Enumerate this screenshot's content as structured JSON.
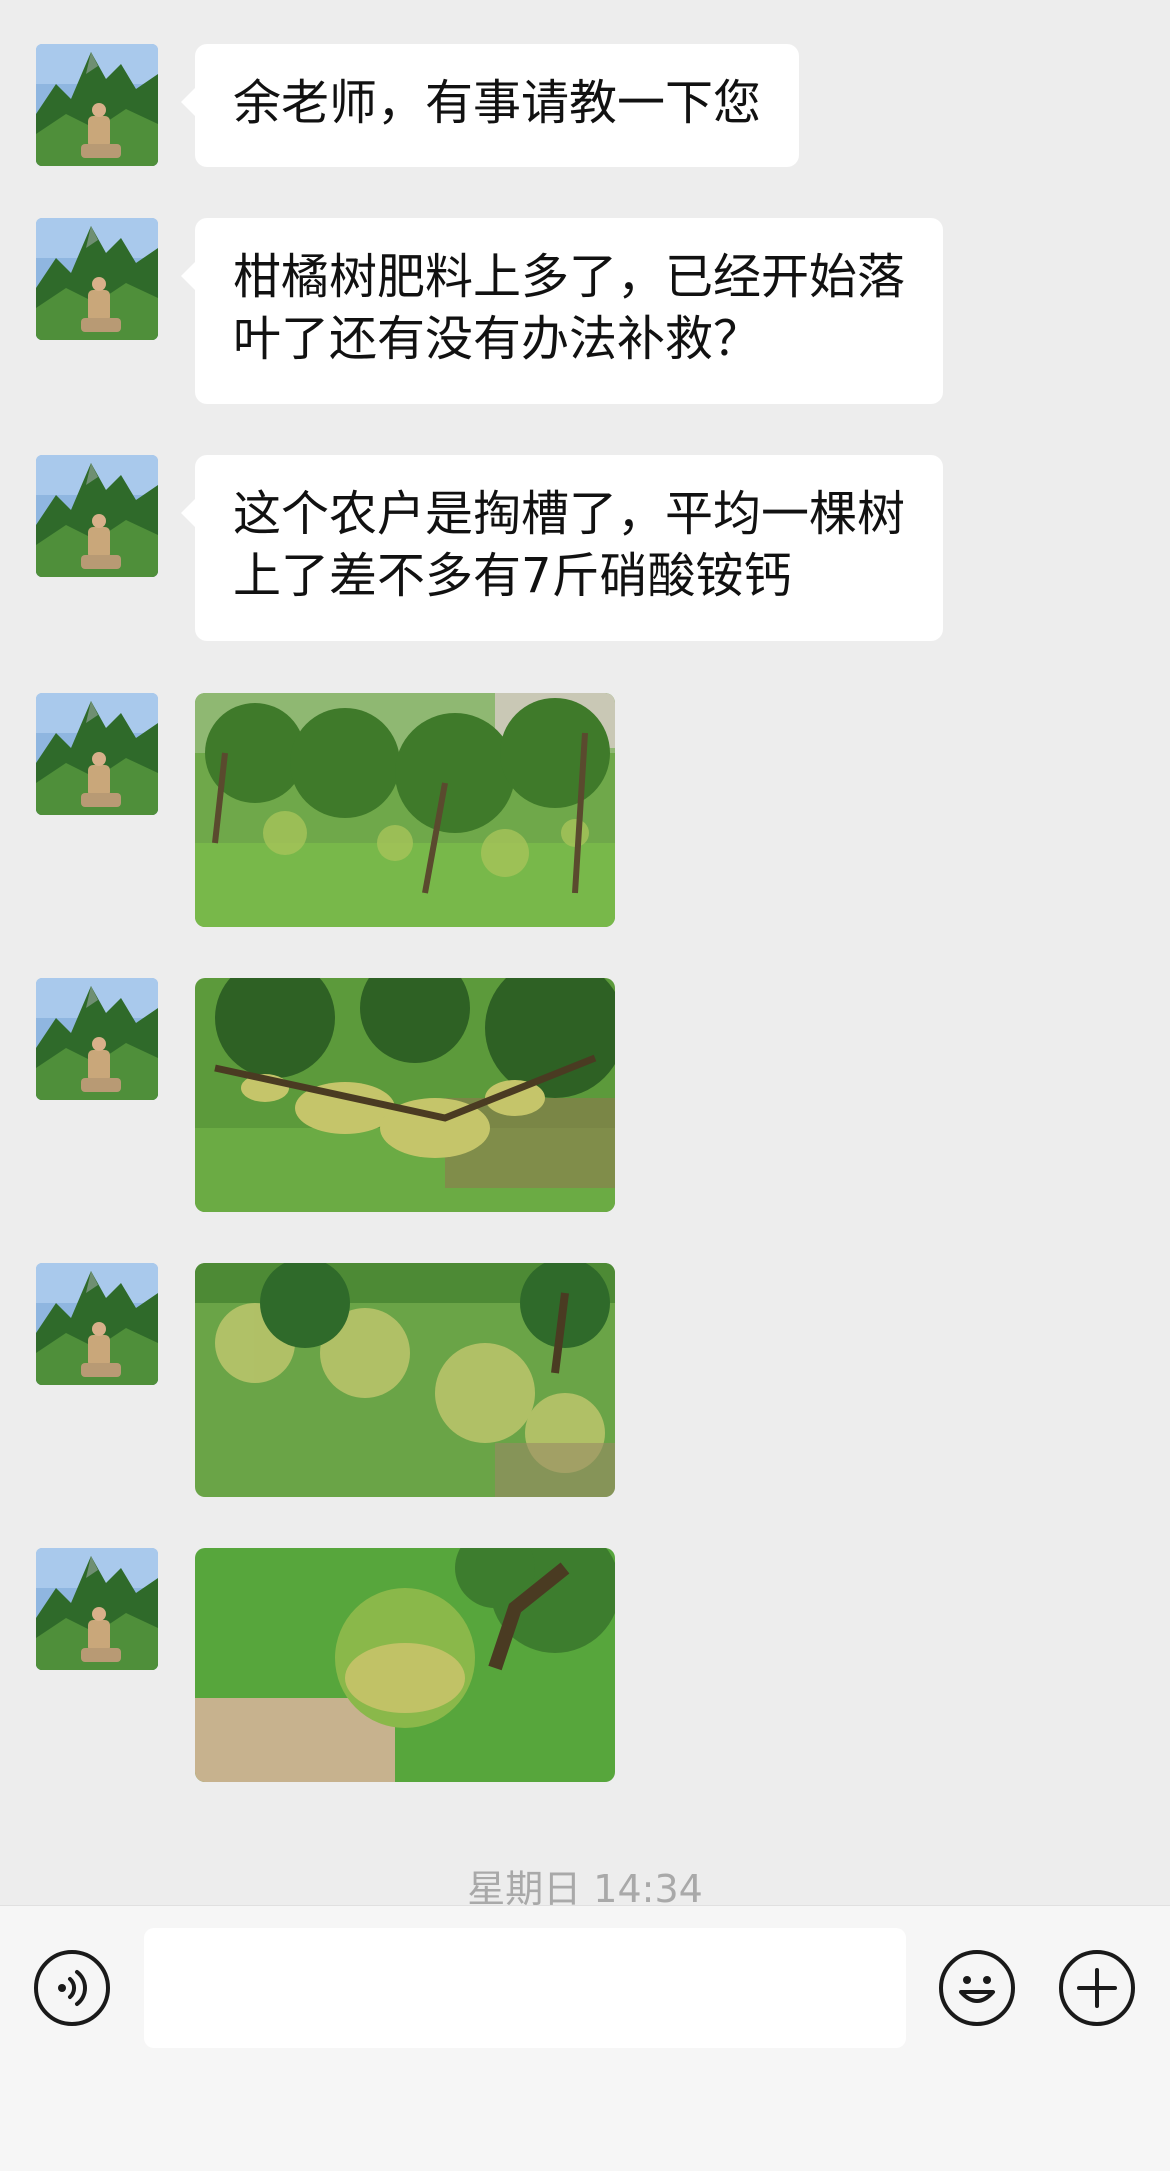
{
  "messages": {
    "m1": {
      "text": "余老师，有事请教一下您"
    },
    "m2": {
      "line1": "柑橘树肥料上多了，已经开始落",
      "line2": "叶了还有没有办法补救？"
    },
    "m3": {
      "line1": "这个农户是掏槽了，平均一棵树",
      "line2": "上了差不多有7斤硝酸铵钙"
    }
  },
  "timestamp": "星期日 14:34",
  "input_bar": {
    "voice_icon": "voice-icon",
    "emoji_icon": "emoji-icon",
    "plus_icon": "plus-icon",
    "text_value": ""
  },
  "colors": {
    "background": "#ededed",
    "bubble": "#ffffff",
    "text": "#111111",
    "timestamp": "#a9a9a9",
    "input_bar": "#f6f6f6"
  }
}
